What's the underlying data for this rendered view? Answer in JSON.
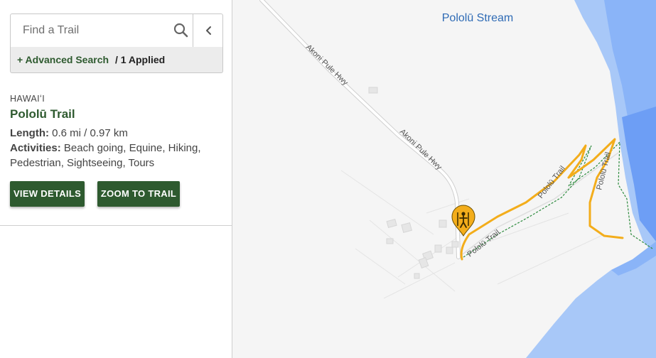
{
  "search": {
    "placeholder": "Find a Trail",
    "value": ""
  },
  "filters": {
    "advanced_label": "+ Advanced Search",
    "applied_label": "/ 1 Applied"
  },
  "result": {
    "region": "HAWAIʻI",
    "name": "Pololū Trail",
    "length_label": "Length:",
    "length_value": "0.6 mi / 0.97 km",
    "activities_label": "Activities:",
    "activities_value": "Beach going, Equine, Hiking, Pedestrian, Sightseeing, Tours",
    "view_details_label": "VIEW DETAILS",
    "zoom_label": "ZOOM TO TRAIL"
  },
  "map": {
    "stream_label": "Pololū Stream",
    "road_label_1": "Akoni Pule Hwy",
    "road_label_2": "Akoni Pule Hwy",
    "trail_label_1": "Pololū Trail",
    "trail_label_2": "Pololū Trail",
    "trail_label_3": "Pololū Trail",
    "colors": {
      "land": "#f5f5f5",
      "water_light": "#a8c8f8",
      "water_mid": "#8ab4f8",
      "water_dark": "#6d9ef5",
      "trail": "#f3ad1b",
      "footpath": "#2e8b3e",
      "brand_green": "#2e5a2f"
    }
  }
}
